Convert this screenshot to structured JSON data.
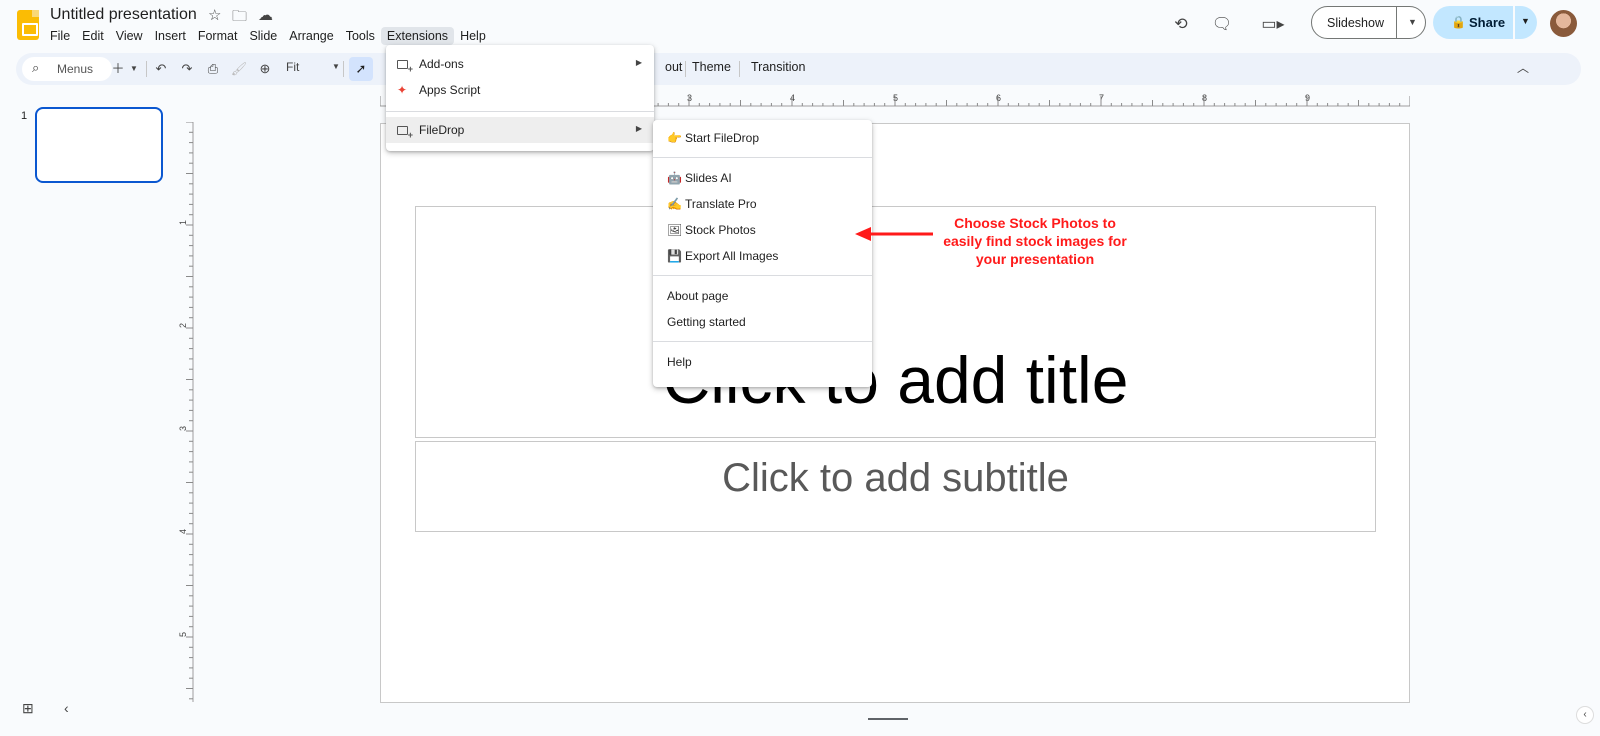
{
  "header": {
    "title": "Untitled presentation",
    "menu": [
      "File",
      "Edit",
      "View",
      "Insert",
      "Format",
      "Slide",
      "Arrange",
      "Tools",
      "Extensions",
      "Help"
    ],
    "active_menu": "Extensions",
    "slideshow_label": "Slideshow",
    "share_label": "Share"
  },
  "toolbar": {
    "search_placeholder": "Menus",
    "zoom": "Fit",
    "layout_partial": "out",
    "theme": "Theme",
    "transition": "Transition"
  },
  "filmstrip": {
    "slide_number": "1"
  },
  "slide": {
    "title_placeholder": "Click to add title",
    "subtitle_placeholder": "Click to add subtitle"
  },
  "rulers": {
    "top_labels": [
      "3",
      "4",
      "5",
      "6",
      "7",
      "8",
      "9"
    ],
    "left_labels": [
      "1",
      "2",
      "3",
      "4",
      "5"
    ]
  },
  "extensions_menu": {
    "addons": "Add-ons",
    "apps_script": "Apps Script",
    "filedrop": "FileDrop"
  },
  "filedrop_menu": {
    "start": "Start FileDrop",
    "slides_ai": "Slides AI",
    "translate_pro": "Translate Pro",
    "stock_photos": "Stock Photos",
    "export_images": "Export All Images",
    "about": "About page",
    "getting_started": "Getting started",
    "help": "Help",
    "icons": {
      "start": "👉",
      "slides_ai": "🤖",
      "translate_pro": "✍",
      "stock_photos": "🖼",
      "export_images": "💾"
    }
  },
  "annotation": {
    "line1": "Choose Stock Photos to",
    "line2": "easily find stock images for",
    "line3": "your presentation",
    "color": "#ff1a1a"
  }
}
